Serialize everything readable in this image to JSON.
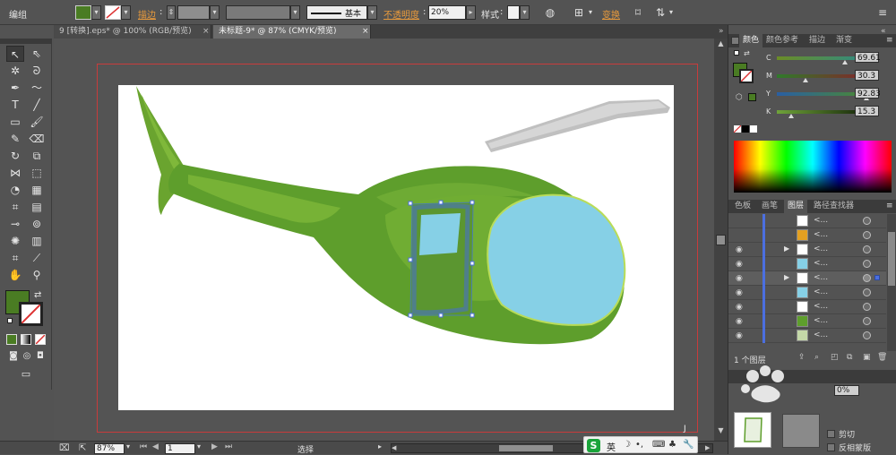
{
  "control_bar": {
    "selection_label": "编组",
    "stroke_label": "描边",
    "stroke_style": "基本",
    "opacity_label": "不透明度",
    "opacity_value": "20%",
    "style_label": "样式",
    "transform_label": "变换"
  },
  "tabs": [
    {
      "label": "9 [转换].eps* @ 100% (RGB/预览)",
      "close": "×"
    },
    {
      "label": "未标题-9* @ 87% (CMYK/预览)",
      "close": "×"
    }
  ],
  "color_panel": {
    "tabs": [
      "颜色",
      "颜色参考",
      "描边",
      "渐变"
    ],
    "channels": [
      {
        "label": "C",
        "value": "69.61",
        "level": 0.7
      },
      {
        "label": "M",
        "value": "30.3",
        "level": 0.3
      },
      {
        "label": "Y",
        "value": "92.83",
        "level": 0.93
      },
      {
        "label": "K",
        "value": "15.3",
        "level": 0.15
      }
    ],
    "fill_color": "#4a7c23"
  },
  "layers_panel": {
    "tabs": [
      "色板",
      "画笔",
      "图层",
      "路径查找器"
    ],
    "row_name": "<...",
    "footer_label": "1 个图层"
  },
  "lower_panel": {
    "clip_label": "剪切",
    "invert_mask_label": "反相蒙版",
    "opacity_value": "0%"
  },
  "status_bar": {
    "zoom": "87%",
    "page": "1",
    "tool": "选择"
  },
  "ime_bar": {
    "lang": "英"
  },
  "colors": {
    "accent_blue": "#4b6fe0",
    "helicopter_green": "#5e9e2c",
    "window_blue": "#86d0e6",
    "artboard_border": "#c83c3c"
  }
}
